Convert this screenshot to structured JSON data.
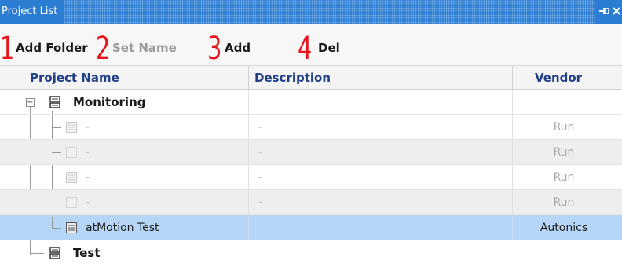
{
  "titlebar": {
    "title": "Project List",
    "pin_icon": "pin-icon",
    "close_icon": "close-icon"
  },
  "toolbar": {
    "annotations": [
      "1",
      "2",
      "3",
      "4"
    ],
    "add_folder_label": "Add Folder",
    "set_name_label": "Set Name",
    "add_label": "Add",
    "del_label": "Del"
  },
  "columns": {
    "name": "Project Name",
    "description": "Description",
    "vendor": "Vendor"
  },
  "rows": [
    {
      "type": "group",
      "name": "Monitoring",
      "description": "",
      "vendor": ""
    },
    {
      "type": "item",
      "name": "-",
      "description": "-",
      "vendor": "Run"
    },
    {
      "type": "item",
      "name": "-",
      "description": "-",
      "vendor": "Run"
    },
    {
      "type": "item",
      "name": "-",
      "description": "-",
      "vendor": "Run"
    },
    {
      "type": "item",
      "name": "-",
      "description": "-",
      "vendor": "Run"
    },
    {
      "type": "item",
      "name": "atMotion Test",
      "description": "",
      "vendor": "Autonics"
    },
    {
      "type": "group",
      "name": "Test",
      "description": "",
      "vendor": ""
    }
  ],
  "colors": {
    "titlebar": "#2b7dd3",
    "header_text": "#1f3f86",
    "annotation": "#e8141d",
    "selected_row": "#b5d6f7"
  }
}
